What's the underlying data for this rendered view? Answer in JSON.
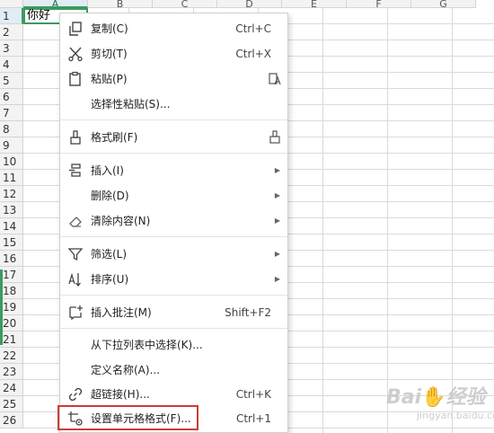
{
  "sheet": {
    "columns": [
      "A",
      "B",
      "C",
      "D",
      "E",
      "F",
      "G"
    ],
    "rows": [
      "1",
      "2",
      "3",
      "4",
      "5",
      "6",
      "7",
      "8",
      "9",
      "10",
      "11",
      "12",
      "13",
      "14",
      "15",
      "16",
      "17",
      "18",
      "19",
      "20",
      "21",
      "22",
      "23",
      "24",
      "25",
      "26"
    ],
    "active_cell_value": "你好"
  },
  "menu": {
    "copy": {
      "label": "复制(C)",
      "shortcut": "Ctrl+C",
      "icon": "copy-icon"
    },
    "cut": {
      "label": "剪切(T)",
      "shortcut": "Ctrl+X",
      "icon": "scissors-icon"
    },
    "paste": {
      "label": "粘贴(P)",
      "icon": "clipboard-icon"
    },
    "paste_special": {
      "label": "选择性粘贴(S)..."
    },
    "format_painter": {
      "label": "格式刷(F)",
      "icon": "paintbrush-icon"
    },
    "insert": {
      "label": "插入(I)",
      "icon": "insert-rows-icon"
    },
    "delete": {
      "label": "删除(D)"
    },
    "clear": {
      "label": "清除内容(N)",
      "icon": "eraser-icon"
    },
    "filter": {
      "label": "筛选(L)",
      "icon": "filter-icon"
    },
    "sort": {
      "label": "排序(U)",
      "icon": "sort-icon"
    },
    "insert_comment": {
      "label": "插入批注(M)",
      "shortcut": "Shift+F2",
      "icon": "comment-icon"
    },
    "dropdown_pick": {
      "label": "从下拉列表中选择(K)..."
    },
    "define_name": {
      "label": "定义名称(A)..."
    },
    "hyperlink": {
      "label": "超链接(H)...",
      "shortcut": "Ctrl+K",
      "icon": "link-icon"
    },
    "format_cells": {
      "label": "设置单元格格式(F)...",
      "shortcut": "Ctrl+1",
      "icon": "format-cells-icon"
    }
  },
  "colors": {
    "accent_green": "#3c9a5f",
    "highlight_red": "#d03a3a"
  }
}
